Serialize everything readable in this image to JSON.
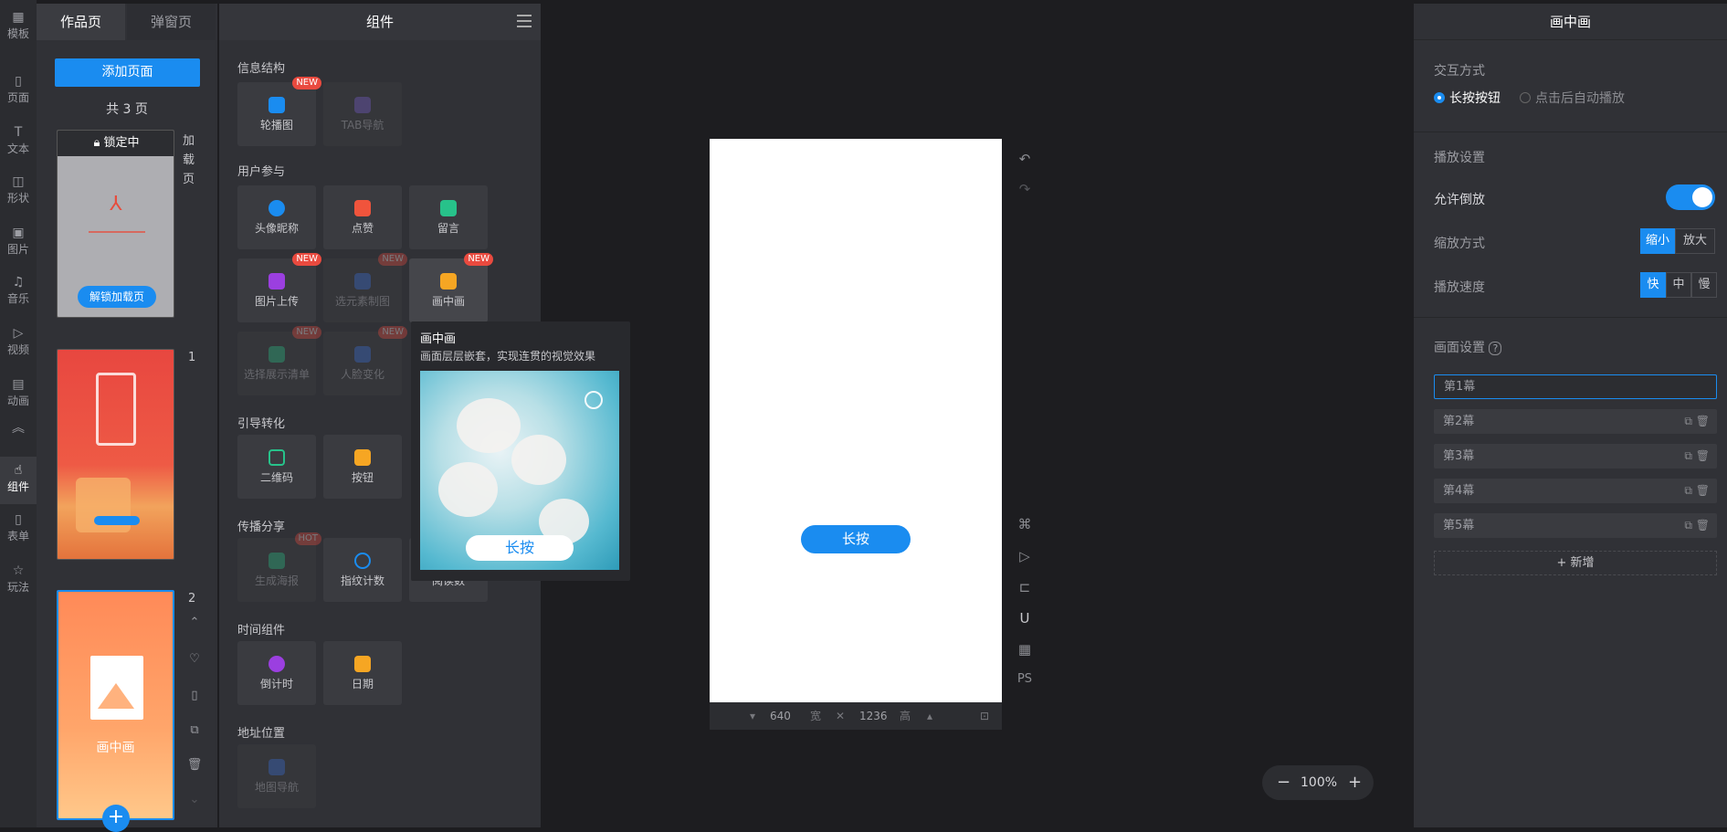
{
  "rail": {
    "items": [
      {
        "label": "模板",
        "icon": "template-icon"
      },
      {
        "label": "页面",
        "icon": "page-icon"
      },
      {
        "label": "文本",
        "icon": "text-icon"
      },
      {
        "label": "形状",
        "icon": "shape-icon"
      },
      {
        "label": "图片",
        "icon": "image-icon"
      },
      {
        "label": "音乐",
        "icon": "music-icon"
      },
      {
        "label": "视频",
        "icon": "video-icon"
      },
      {
        "label": "动画",
        "icon": "animation-icon"
      },
      {
        "label": "组件",
        "icon": "component-icon"
      },
      {
        "label": "表单",
        "icon": "form-icon"
      },
      {
        "label": "玩法",
        "icon": "gameplay-icon"
      }
    ],
    "collapse_glyph": "︽"
  },
  "pages": {
    "tabs": [
      "作品页",
      "弹窗页"
    ],
    "add_label": "添加页面",
    "count_label": "共 3 页",
    "loading_header": "锁定中",
    "unlock_label": "解锁加载页",
    "loading_label": "加载页",
    "page1_number": "1",
    "page2_number": "2",
    "page2_title": "画中画",
    "add_glyph": "+"
  },
  "components": {
    "title": "组件",
    "sections": {
      "info": "信息结构",
      "engage": "用户参与",
      "guide": "引导转化",
      "share": "传播分享",
      "time": "时间组件",
      "address": "地址位置"
    },
    "items": {
      "carousel": "轮播图",
      "tabnav": "TAB导航",
      "avatar": "头像昵称",
      "like": "点赞",
      "comment": "留言",
      "upload": "图片上传",
      "element_draw": "选元素制图",
      "pip": "画中画",
      "choose_list": "选择展示清单",
      "face_change": "人脸变化",
      "qrcode": "二维码",
      "button": "按钮",
      "poster": "生成海报",
      "fingerprint": "指纹计数",
      "read_count": "阅读数",
      "countdown": "倒计时",
      "date": "日期",
      "map_nav": "地图导航"
    },
    "badges": {
      "new": "NEW",
      "hot": "HOT"
    }
  },
  "tooltip": {
    "title": "画中画",
    "desc": "画面层层嵌套，实现连贯的视觉效果",
    "preview_button": "长按"
  },
  "canvas": {
    "button_label": "长按",
    "width_value": "640",
    "width_unit": "宽",
    "height_value": "1236",
    "height_unit": "高",
    "times_glyph": "✕",
    "zoom_label": "100%",
    "ps_label": "PS"
  },
  "props": {
    "title": "画中画",
    "interaction_label": "交互方式",
    "interaction_options": [
      "长按按钮",
      "点击后自动播放"
    ],
    "playback_label": "播放设置",
    "allow_reverse": "允许倒放",
    "allow_reverse_on": true,
    "zoom_mode_label": "缩放方式",
    "zoom_options": [
      "缩小",
      "放大"
    ],
    "speed_label": "播放速度",
    "speed_options": [
      "快",
      "中",
      "慢"
    ],
    "scene_label": "画面设置",
    "scenes": [
      "第1幕",
      "第2幕",
      "第3幕",
      "第4幕",
      "第5幕"
    ],
    "add_scene": "+ 新增"
  },
  "colors": {
    "accent": "#1a8cf0",
    "panel": "#303136",
    "badge": "#e94a3f"
  }
}
